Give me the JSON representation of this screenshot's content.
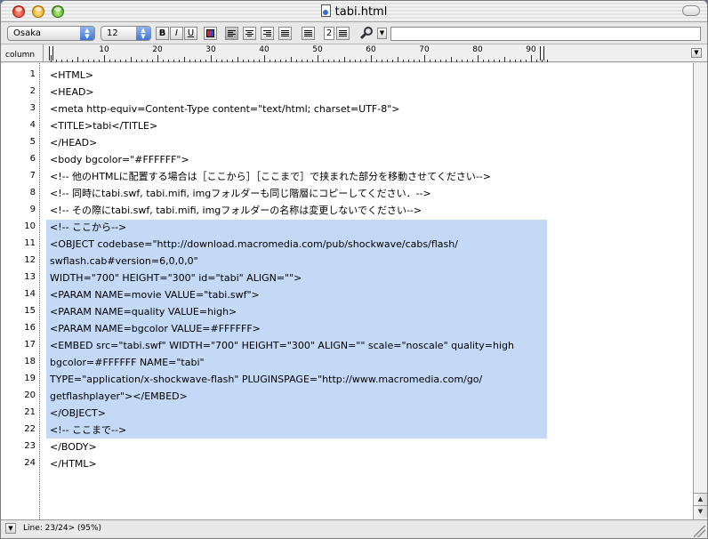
{
  "window": {
    "title": "tabi.html"
  },
  "toolbar": {
    "font_name": "Osaka",
    "font_size": "12",
    "bold_label": "B",
    "italic_label": "I",
    "underline_label": "U",
    "spacing_value": "2",
    "search_value": ""
  },
  "ruler": {
    "label": "column",
    "numbers": [
      "10",
      "20",
      "30",
      "40",
      "50",
      "60",
      "70",
      "80",
      "90"
    ]
  },
  "editor": {
    "line_numbers": [
      "1",
      "2",
      "3",
      "4",
      "5",
      "6",
      "7",
      "8",
      "9",
      "10",
      "11",
      "12",
      "13",
      "14",
      "15",
      "16",
      "17",
      "18",
      "19",
      "20",
      "21",
      "22",
      "23",
      "24"
    ],
    "lines": [
      "<HTML>",
      "<HEAD>",
      "<meta http-equiv=Content-Type content=\"text/html; charset=UTF-8\">",
      "<TITLE>tabi</TITLE>",
      "</HEAD>",
      "<body bgcolor=\"#FFFFFF\">",
      "<!-- 他のHTMLに配置する場合は［ここから］［ここまで］で挟まれた部分を移動させてください-->",
      "<!-- 同時にtabi.swf, tabi.mifi, imgフォルダーも同じ階層にコピーしてください．-->",
      "<!-- その際にtabi.swf, tabi.mifi, imgフォルダーの名称は変更しないでください-->",
      "<!-- ここから-->",
      "<OBJECT codebase=\"http://download.macromedia.com/pub/shockwave/cabs/flash/",
      "swflash.cab#version=6,0,0,0\"",
      "WIDTH=\"700\" HEIGHT=\"300\" id=\"tabi\" ALIGN=\"\">",
      "<PARAM NAME=movie VALUE=\"tabi.swf\">",
      "<PARAM NAME=quality VALUE=high>",
      "<PARAM NAME=bgcolor VALUE=#FFFFFF>",
      "<EMBED src=\"tabi.swf\" WIDTH=\"700\" HEIGHT=\"300\" ALIGN=\"\" scale=\"noscale\" quality=high",
      "bgcolor=#FFFFFF NAME=\"tabi\"",
      "TYPE=\"application/x-shockwave-flash\" PLUGINSPAGE=\"http://www.macromedia.com/go/",
      "getflashplayer\"></EMBED>",
      "</OBJECT>",
      "<!-- ここまで-->",
      "</BODY>",
      "</HTML>"
    ]
  },
  "status": {
    "text": "Line: 23/24> (95%)"
  },
  "colors": {
    "selection": "#c4d9f5",
    "desktop": "#5a6f9c"
  },
  "icons": [
    "close-button",
    "minimize-button",
    "zoom-button",
    "html-document-icon",
    "magnifier-icon",
    "resize-grip-icon"
  ]
}
